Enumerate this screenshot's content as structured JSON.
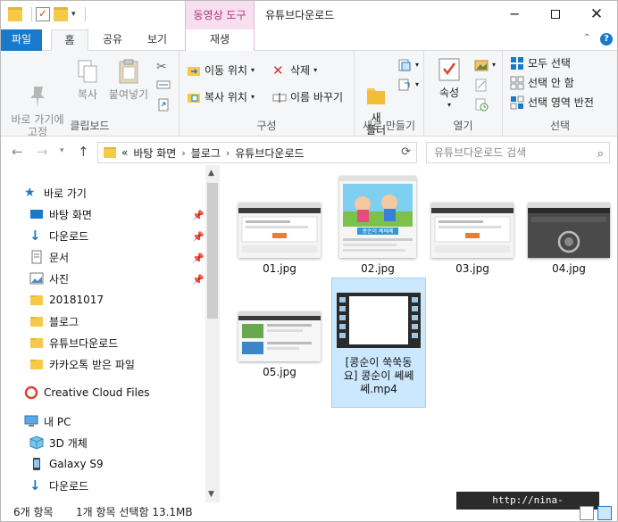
{
  "titlebar": {
    "context_tab_title": "동영상 도구",
    "window_title": "유튜브다운로드",
    "minimize_icon": "─",
    "close_icon": "✕"
  },
  "tabs": {
    "file": "파일",
    "home": "홈",
    "share": "공유",
    "view": "보기",
    "play": "재생"
  },
  "ribbon": {
    "clipboard": {
      "label": "클립보드",
      "pin_quick": "바로 가기에\n고정",
      "copy": "복사",
      "paste": "붙여넣기"
    },
    "organize": {
      "label": "구성",
      "move_to": "이동 위치",
      "copy_to": "복사 위치",
      "delete": "삭제",
      "rename": "이름 바꾸기"
    },
    "new": {
      "label": "새로 만들기",
      "new_folder": "새\n폴더"
    },
    "open": {
      "label": "열기",
      "properties": "속성"
    },
    "select": {
      "label": "선택",
      "select_all": "모두 선택",
      "select_none": "선택 안 함",
      "invert": "선택 영역 반전"
    }
  },
  "address": {
    "prefix": "«",
    "crumbs": [
      "바탕 화면",
      "블로그",
      "유튜브다운로드"
    ],
    "search_placeholder": "유튜브다운로드 검색"
  },
  "sidebar": {
    "quick_access": "바로 가기",
    "items": [
      {
        "label": "바탕 화면",
        "pinned": true
      },
      {
        "label": "다운로드",
        "pinned": true
      },
      {
        "label": "문서",
        "pinned": true
      },
      {
        "label": "사진",
        "pinned": true
      },
      {
        "label": "20181017",
        "pinned": false
      },
      {
        "label": "블로그",
        "pinned": false
      },
      {
        "label": "유튜브다운로드",
        "pinned": false
      },
      {
        "label": "카카오톡 받은 파일",
        "pinned": false
      }
    ],
    "creative_cloud": "Creative Cloud Files",
    "this_pc": "내 PC",
    "pc_items": [
      {
        "label": "3D 개체"
      },
      {
        "label": "Galaxy S9"
      },
      {
        "label": "다운로드"
      }
    ]
  },
  "files": [
    {
      "name": "01.jpg",
      "kind": "image",
      "selected": false
    },
    {
      "name": "02.jpg",
      "kind": "image",
      "selected": false
    },
    {
      "name": "03.jpg",
      "kind": "image",
      "selected": false
    },
    {
      "name": "04.jpg",
      "kind": "image",
      "selected": false
    },
    {
      "name": "05.jpg",
      "kind": "image",
      "selected": false
    },
    {
      "name": "[콩순이 쑥쑥동요] 콩순이 쎄쎄쎄.mp4",
      "name_lines": [
        "[콩순이 쑥쑥동",
        "요] 콩순이 쎄쎄",
        "쎄.mp4"
      ],
      "kind": "video",
      "selected": true
    }
  ],
  "thumb_text": {
    "f02_caption": "콩순이 쎄쎄쎄"
  },
  "status": {
    "count": "6개 항목",
    "selection": "1개 항목 선택함 13.1MB"
  },
  "watermark": "http://nina-life.tistory.com",
  "colors": {
    "accent": "#1979ca",
    "context_tab": "#f7dff0",
    "context_text": "#b0337a",
    "selection_bg": "#cce8ff",
    "selection_border": "#99d1ff",
    "folder": "#f7c948"
  }
}
